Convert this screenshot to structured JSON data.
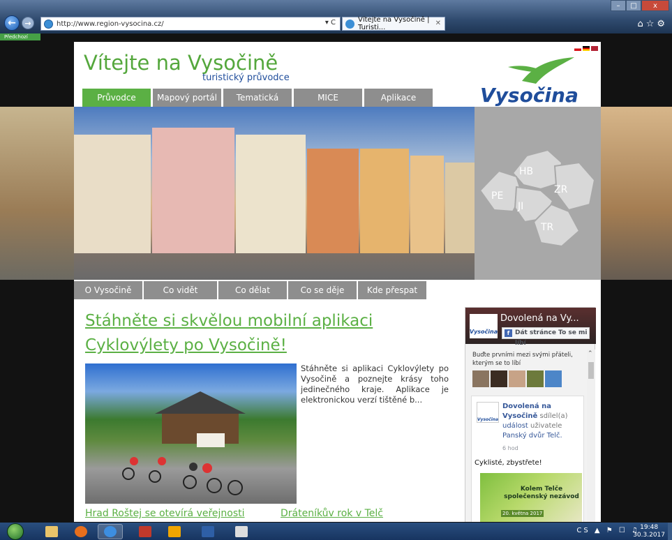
{
  "browser": {
    "url": "http://www.region-vysocina.cz/",
    "tab_title": "Vítejte na Vysočině | Turisti...",
    "window_buttons": [
      "–",
      "□",
      "x"
    ],
    "green_tab_label": "Předchozí",
    "refresh_icons": "▾ C"
  },
  "site": {
    "title": "Vítejte na Vysočině",
    "subtitle": "turistický průvodce",
    "logo_text": "Vysočina",
    "main_menu": [
      {
        "label": "Průvodce",
        "active": true
      },
      {
        "label": "Mapový portál",
        "active": false
      },
      {
        "label": "Tematická nabídka",
        "active": false
      },
      {
        "label": "MICE",
        "active": false
      },
      {
        "label": "Aplikace",
        "active": false
      }
    ],
    "map_regions": [
      "HB",
      "PE",
      "ZR",
      "JI",
      "TR"
    ],
    "search_placeholder": "",
    "sub_menu": [
      "O Vysočině",
      "Co vidět",
      "Co dělat",
      "Co se děje",
      "Kde přespat"
    ]
  },
  "article": {
    "headline": "Stáhněte si skvělou mobilní aplikaci Cyklovýlety po Vysočině!",
    "teaser": "Stáhněte si aplikaci Cyklovýlety po Vysočině a poznejte krásy toho jedinečného kraje. Aplikace je elektronickou verzí tištěné b...",
    "link1": "Hrad Roštej se otevírá veřejnosti",
    "link2": "Dráteníkův rok v Telč"
  },
  "facebook": {
    "page_title": "Dovolená na Vy...",
    "like_label": "Dát stránce To se mi líbí",
    "friends_text": "Buďte prvními mezi svými přáteli, kterým se to líbí",
    "post_author": "Dovolená na Vysočině",
    "post_action": "sdílel(a)",
    "post_object": "událost",
    "post_user_label": "uživatele",
    "post_user": "Panský dvůr Telč.",
    "post_time": "6 hod",
    "post_message": "Cyklisté, zbystřete!",
    "ad_title": "Kolem Telče společenský nezávod",
    "ad_date": "20. května 2017"
  },
  "taskbar": {
    "language": "CS",
    "time": "19:48",
    "date": "30.3.2017"
  }
}
